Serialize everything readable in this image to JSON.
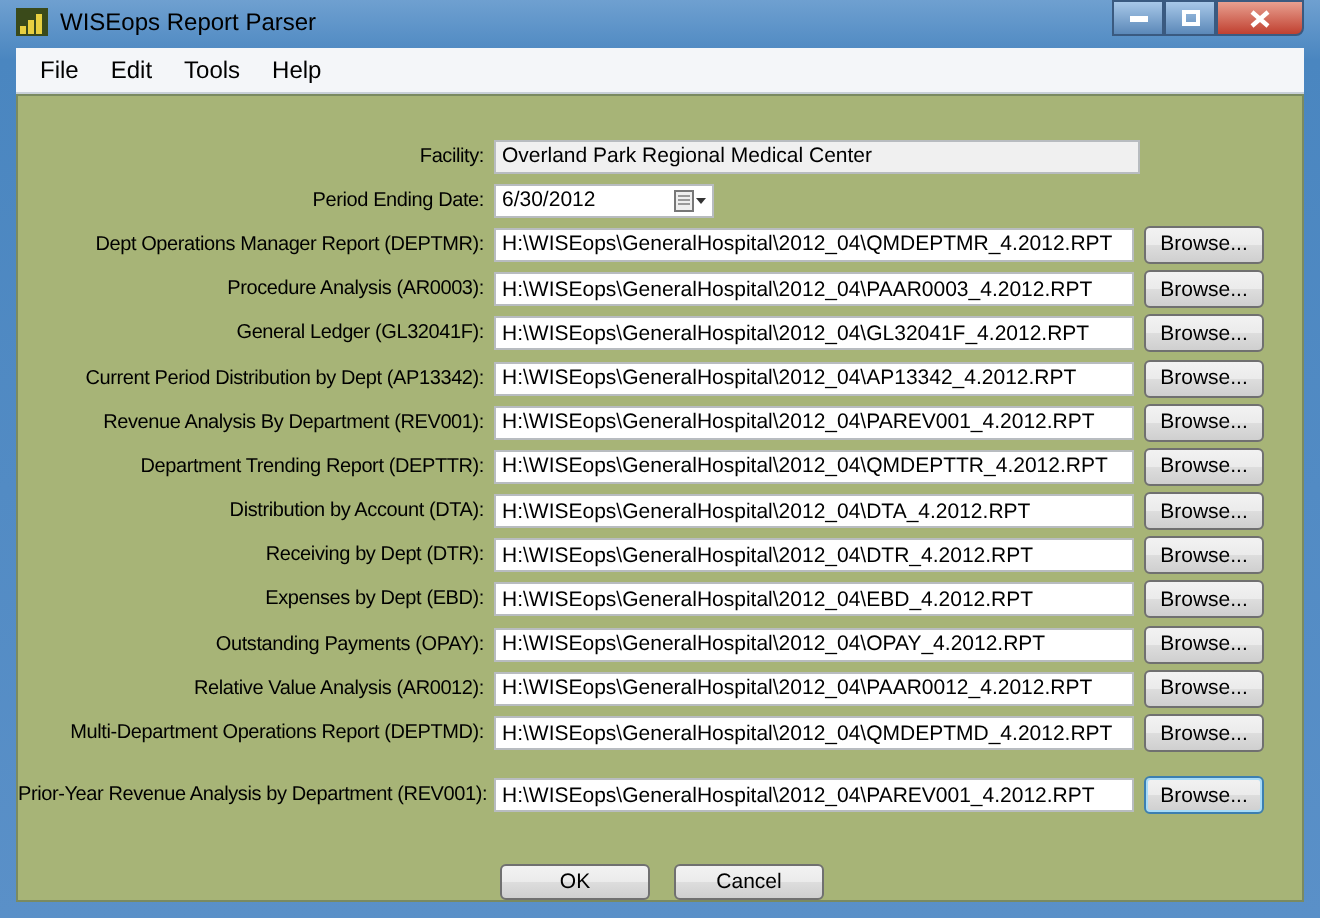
{
  "window": {
    "title": "WISEops Report Parser"
  },
  "menu": [
    "File",
    "Edit",
    "Tools",
    "Help"
  ],
  "facility": {
    "label": "Facility:",
    "value": "Overland Park Regional Medical Center",
    "disabled": true
  },
  "period": {
    "label": "Period Ending Date:",
    "value": "6/30/2012"
  },
  "reports": [
    {
      "label": "Dept Operations Manager Report (DEPTMR):",
      "path": "H:\\WISEops\\GeneralHospital\\2012_04\\QMDEPTMR_4.2012.RPT",
      "button": "Browse...",
      "focused": false
    },
    {
      "label": "Procedure Analysis (AR0003):",
      "path": "H:\\WISEops\\GeneralHospital\\2012_04\\PAAR0003_4.2012.RPT",
      "button": "Browse...",
      "focused": false
    },
    {
      "label": "General Ledger (GL32041F):",
      "path": "H:\\WISEops\\GeneralHospital\\2012_04\\GL32041F_4.2012.RPT",
      "button": "Browse...",
      "focused": false
    },
    {
      "label": "Current Period Distribution by Dept (AP13342):",
      "path": "H:\\WISEops\\GeneralHospital\\2012_04\\AP13342_4.2012.RPT",
      "button": "Browse...",
      "focused": false
    },
    {
      "label": "Revenue Analysis By Department (REV001):",
      "path": "H:\\WISEops\\GeneralHospital\\2012_04\\PAREV001_4.2012.RPT",
      "button": "Browse...",
      "focused": false
    },
    {
      "label": "Department Trending Report (DEPTTR):",
      "path": "H:\\WISEops\\GeneralHospital\\2012_04\\QMDEPTTR_4.2012.RPT",
      "button": "Browse...",
      "focused": false
    },
    {
      "label": "Distribution by Account (DTA):",
      "path": "H:\\WISEops\\GeneralHospital\\2012_04\\DTA_4.2012.RPT",
      "button": "Browse...",
      "focused": false
    },
    {
      "label": "Receiving by Dept (DTR):",
      "path": "H:\\WISEops\\GeneralHospital\\2012_04\\DTR_4.2012.RPT",
      "button": "Browse...",
      "focused": false
    },
    {
      "label": "Expenses by Dept (EBD):",
      "path": "H:\\WISEops\\GeneralHospital\\2012_04\\EBD_4.2012.RPT",
      "button": "Browse...",
      "focused": false
    },
    {
      "label": "Outstanding Payments (OPAY):",
      "path": "H:\\WISEops\\GeneralHospital\\2012_04\\OPAY_4.2012.RPT",
      "button": "Browse...",
      "focused": false
    },
    {
      "label": "Relative Value Analysis (AR0012):",
      "path": "H:\\WISEops\\GeneralHospital\\2012_04\\PAAR0012_4.2012.RPT",
      "button": "Browse...",
      "focused": false
    },
    {
      "label": "Multi-Department Operations Report (DEPTMD):",
      "path": "H:\\WISEops\\GeneralHospital\\2012_04\\QMDEPTMD_4.2012.RPT",
      "button": "Browse...",
      "focused": false
    }
  ],
  "prior_year": {
    "label": "Prior-Year Revenue Analysis by Department (REV001):",
    "path": "H:\\WISEops\\GeneralHospital\\2012_04\\PAREV001_4.2012.RPT",
    "button": "Browse...",
    "focused": true
  },
  "buttons": [
    "OK",
    "Cancel"
  ]
}
